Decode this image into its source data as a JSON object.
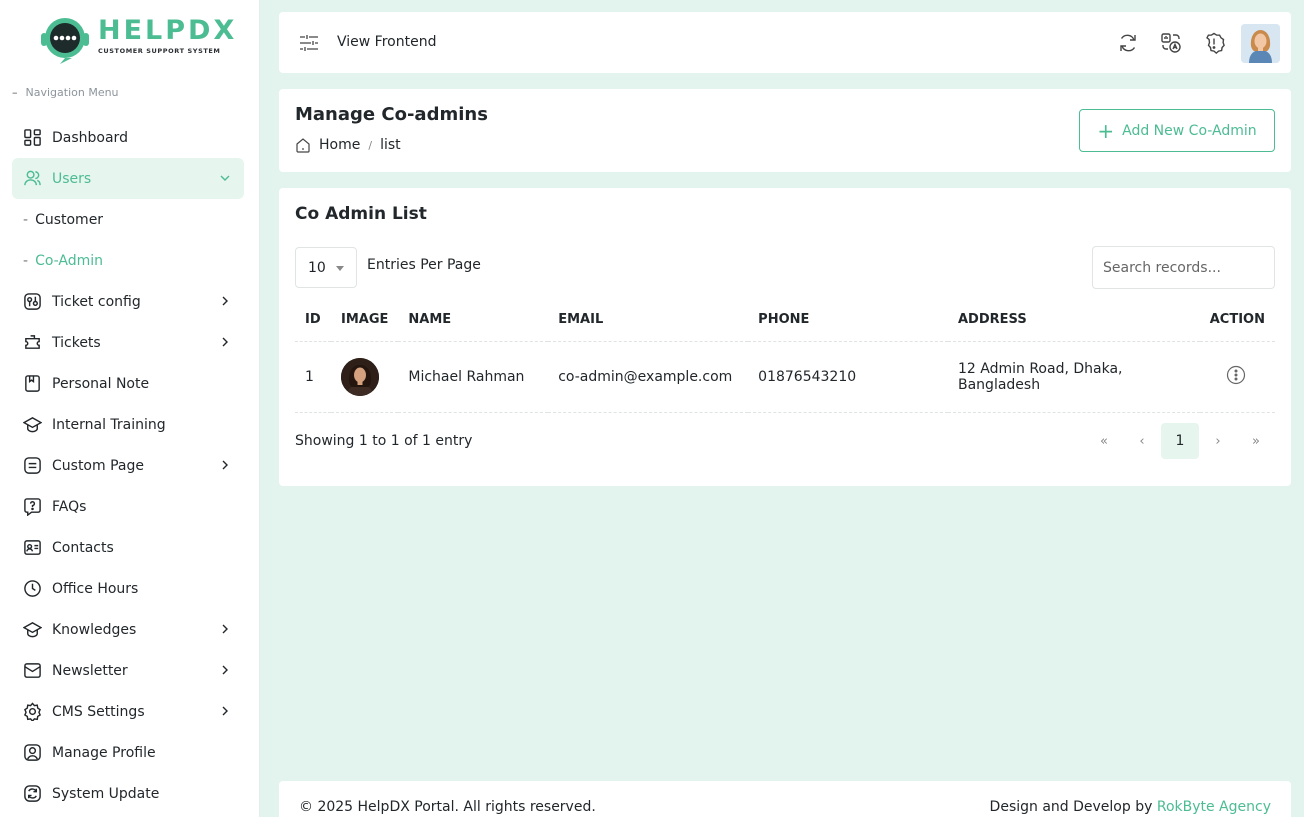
{
  "brand": {
    "name": "HELPDX",
    "tagline": "CUSTOMER SUPPORT SYSTEM",
    "accent": "#4cbc93"
  },
  "sidebar": {
    "heading": "Navigation Menu",
    "items": [
      {
        "label": "Dashboard",
        "icon": "dashboard-icon"
      },
      {
        "label": "Users",
        "icon": "users-icon",
        "active": true,
        "expanded": true
      },
      {
        "label": "Ticket config",
        "icon": "ticket-config-icon"
      },
      {
        "label": "Tickets",
        "icon": "tickets-icon"
      },
      {
        "label": "Personal Note",
        "icon": "note-icon"
      },
      {
        "label": "Internal Training",
        "icon": "training-icon"
      },
      {
        "label": "Custom Page",
        "icon": "custom-page-icon"
      },
      {
        "label": "FAQs",
        "icon": "faq-icon"
      },
      {
        "label": "Contacts",
        "icon": "contacts-icon"
      },
      {
        "label": "Office Hours",
        "icon": "clock-icon"
      },
      {
        "label": "Knowledges",
        "icon": "knowledge-icon"
      },
      {
        "label": "Newsletter",
        "icon": "newsletter-icon"
      },
      {
        "label": "CMS Settings",
        "icon": "gear-icon"
      },
      {
        "label": "Manage Profile",
        "icon": "profile-icon"
      },
      {
        "label": "System Update",
        "icon": "refresh-icon"
      }
    ],
    "sub_items": [
      {
        "label": "Customer"
      },
      {
        "label": "Co-Admin",
        "current": true
      }
    ]
  },
  "header": {
    "view_frontend": "View Frontend",
    "icons": [
      "sync-icon",
      "translate-icon",
      "alert-icon"
    ]
  },
  "page": {
    "title": "Manage Co-admins",
    "breadcrumb": [
      "Home",
      "list"
    ],
    "add_button": "Add New Co-Admin"
  },
  "list": {
    "title": "Co Admin List",
    "per_page": "10",
    "per_page_label": "Entries Per Page",
    "search_placeholder": "Search records...",
    "columns": [
      "ID",
      "IMAGE",
      "NAME",
      "EMAIL",
      "PHONE",
      "ADDRESS",
      "ACTION"
    ],
    "rows": [
      {
        "id": "1",
        "name": "Michael Rahman",
        "email": "co-admin@example.com",
        "phone": "01876543210",
        "address": "12 Admin Road, Dhaka, Bangladesh"
      }
    ],
    "showing": "Showing 1 to 1 of 1 entry",
    "pager": {
      "first": "«",
      "prev": "‹",
      "current": "1",
      "next": "›",
      "last": "»"
    }
  },
  "footer": {
    "copyright": "© 2025 HelpDX Portal. All rights reserved.",
    "credit_prefix": "Design and Develop by",
    "agency": "RokByte Agency"
  }
}
